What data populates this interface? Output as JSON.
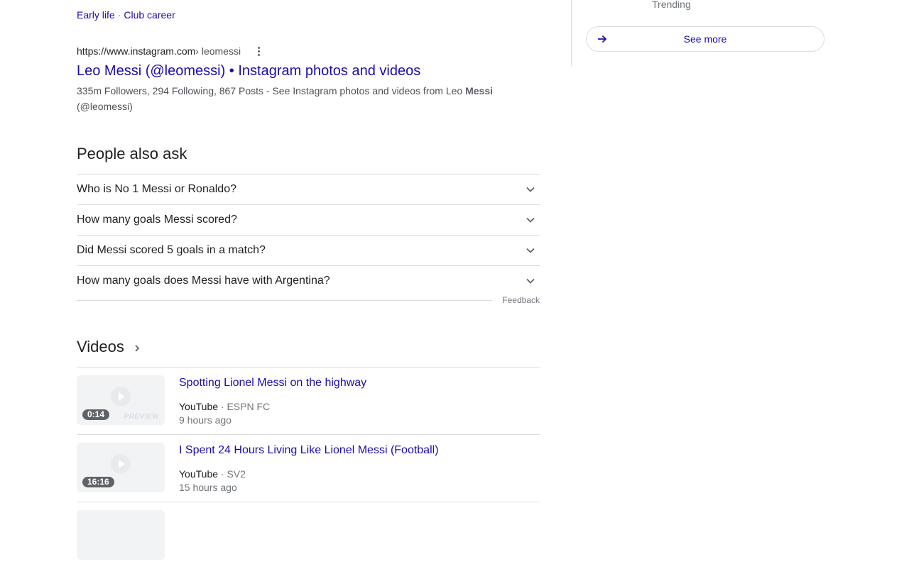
{
  "sitelinks": [
    "Early life",
    "Club career"
  ],
  "result": {
    "url": "https://www.instagram.com",
    "path": " › leomessi",
    "title": "Leo Messi (@leomessi) • Instagram photos and videos",
    "snippet_pre": "335m Followers, 294 Following, 867 Posts - See Instagram photos and videos from Leo ",
    "snippet_bold": "Messi",
    "snippet_post": "(@leomessi)"
  },
  "paa": {
    "heading": "People also ask",
    "questions": [
      "Who is No 1 Messi or Ronaldo?",
      "How many goals Messi scored?",
      "Did Messi scored 5 goals in a match?",
      "How many goals does Messi have with Argentina?"
    ],
    "feedback": "Feedback"
  },
  "videos": {
    "heading": "Videos",
    "items": [
      {
        "title": "Spotting Lionel Messi on the highway",
        "duration": "0:14",
        "badge": "PREVIEW",
        "source": "YouTube",
        "channel": "ESPN FC",
        "time": "9 hours ago"
      },
      {
        "title": "I Spent 24 Hours Living Like Lionel Messi (Football)",
        "duration": "16:16",
        "source": "YouTube",
        "channel": "SV2",
        "time": "15 hours ago"
      }
    ]
  },
  "sidebar": {
    "trending": "Trending",
    "see_more": "See more"
  },
  "colors": {
    "link": "#1a0dab",
    "divider": "#dadce0",
    "muted": "#70757a"
  }
}
